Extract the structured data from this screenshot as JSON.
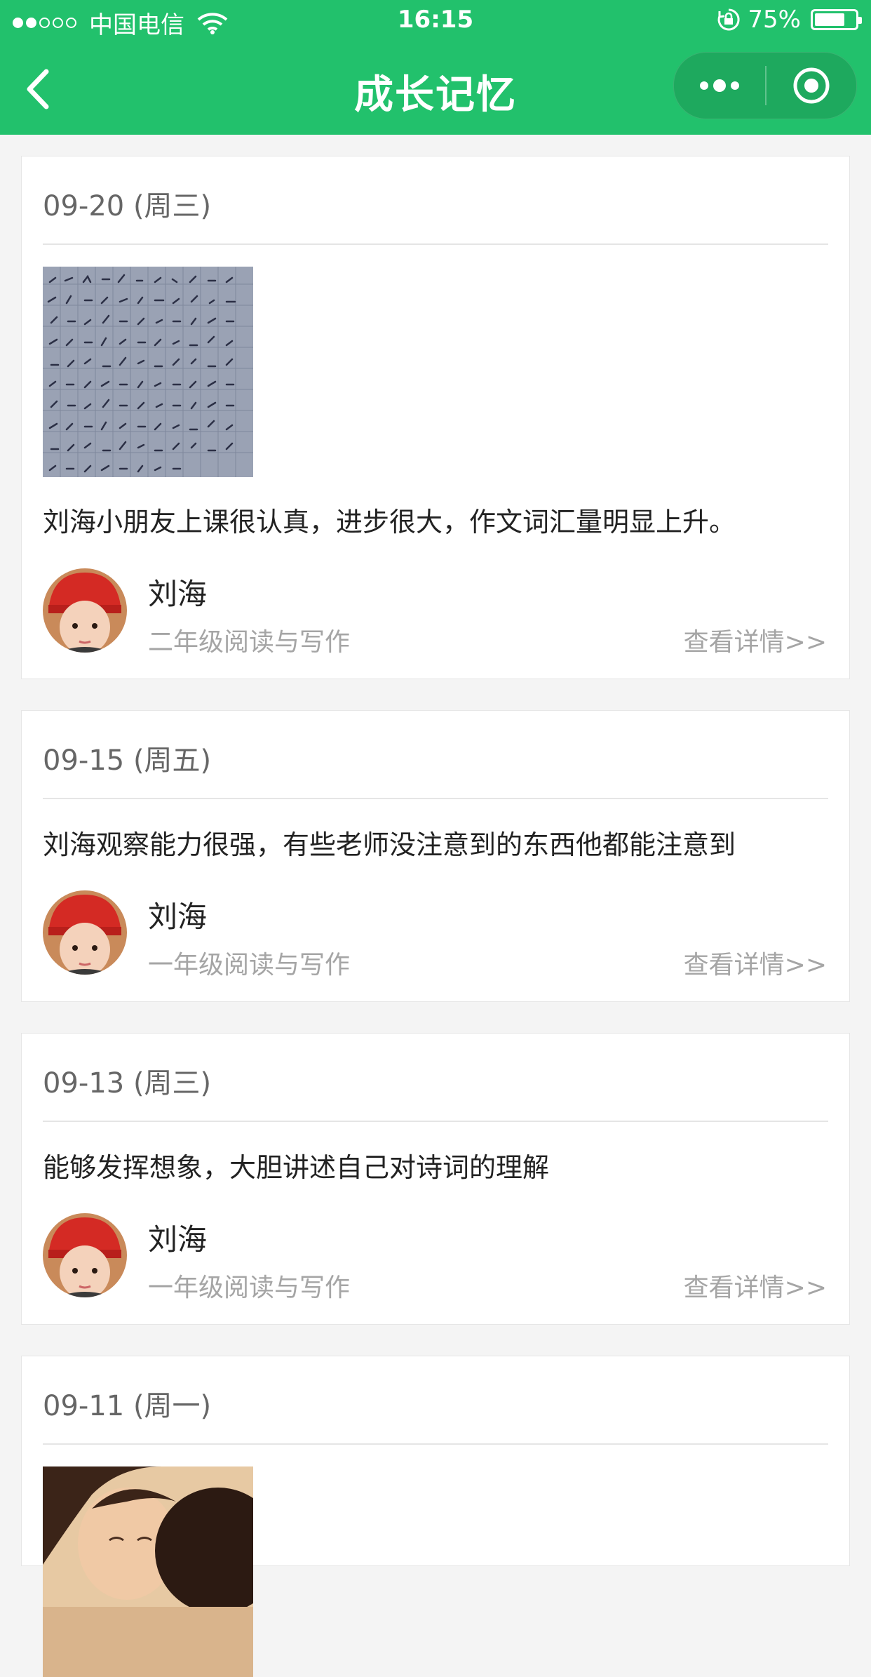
{
  "status_bar": {
    "carrier": "中国电信",
    "time": "16:15",
    "battery_percent": "75%",
    "battery_level": 0.75
  },
  "nav": {
    "title": "成长记忆",
    "back_icon": "back-chevron-icon",
    "more_icon": "more-dots-icon",
    "close_icon": "target-circle-icon"
  },
  "cards": [
    {
      "date": "09-20 (周三)",
      "remark": "刘海小朋友上课很认真，进步很大，作文词汇量明显上升。",
      "student": "刘海",
      "course": "二年级阅读与写作",
      "detail": "查看详情>>"
    },
    {
      "date": "09-15 (周五)",
      "remark": "刘海观察能力很强，有些老师没注意到的东西他都能注意到",
      "student": "刘海",
      "course": "一年级阅读与写作",
      "detail": "查看详情>>"
    },
    {
      "date": "09-13 (周三)",
      "remark": "能够发挥想象，大胆讲述自己对诗词的理解",
      "student": "刘海",
      "course": "一年级阅读与写作",
      "detail": "查看详情>>"
    },
    {
      "date": "09-11 (周一)"
    }
  ],
  "colors": {
    "brand_green": "#22c16c",
    "page_bg": "#f4f4f4",
    "muted_text": "#a5a5a5"
  }
}
